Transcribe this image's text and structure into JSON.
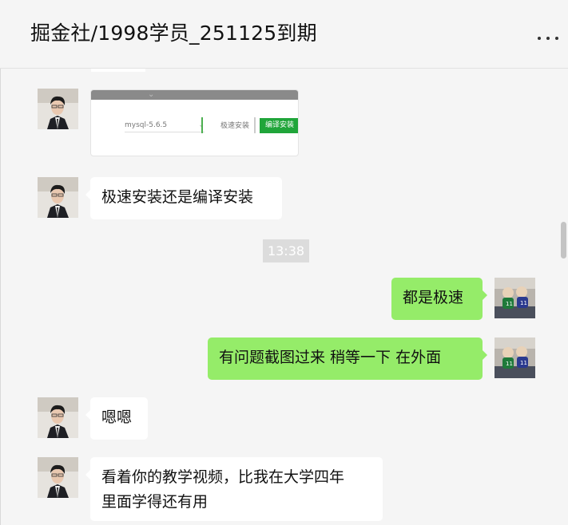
{
  "header": {
    "title": "掘金社/1998学员_251125到期",
    "more_icon": "more-horizontal-icon"
  },
  "colors": {
    "outgoing_bubble": "#95ec69",
    "incoming_bubble": "#ffffff",
    "background": "#f5f5f5"
  },
  "image_card": {
    "select_label": "mysql-5.6.5",
    "secondary_button": "极速安装",
    "primary_button": "编译安装"
  },
  "messages": [
    {
      "from": "them",
      "text": "极速安装还是编译安装"
    },
    {
      "time": "13:38"
    },
    {
      "from": "me",
      "text": "都是极速"
    },
    {
      "from": "me",
      "text": "有问题截图过来  稍等一下 在外面"
    },
    {
      "from": "them",
      "text": "嗯嗯"
    },
    {
      "from": "them",
      "text": "看着你的教学视频，比我在大学四年里面学得还有用",
      "lines": [
        "看着你的教学视频，比我在大学四年",
        "里面学得还有用"
      ]
    }
  ]
}
